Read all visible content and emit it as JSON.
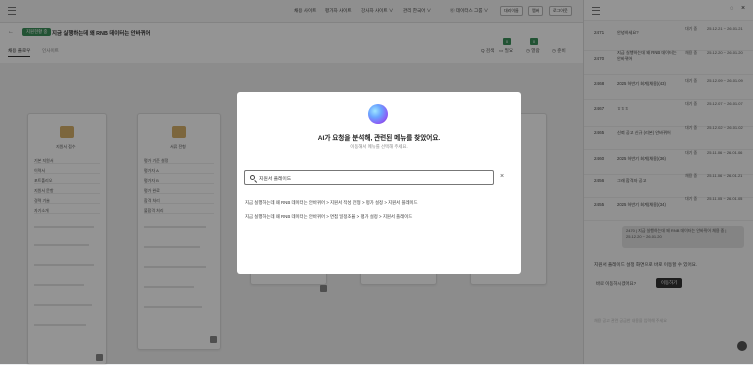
{
  "topbar": {
    "menu": [
      "채용 사이트",
      "평가자 사이트",
      "강사자 사이트 ∨",
      "관리 한국어 ∨",
      "⓪ 데이터스 그룹 ∨"
    ],
    "tags": [
      "대리이름",
      "멤버",
      "로그아웃"
    ]
  },
  "header": {
    "status": "지원현황 중",
    "title": "지금 실행하는데 왜 RNB 데이터는 안바뀌어",
    "tabs": [
      "채용 플로우",
      "인사이트"
    ],
    "tools": [
      "Q 검색",
      "▭ 필요",
      "◷ 열람",
      "◷ 준비"
    ],
    "badges": [
      "0",
      "0"
    ]
  },
  "cards": [
    {
      "title": "지원서 접수",
      "rows": [
        "기본 지원서",
        "이력서",
        "포트폴리오",
        "지원서 문항",
        "경력 기술",
        "자기소개"
      ]
    },
    {
      "title": "서류 전형",
      "rows": [
        "평가 기준 설정",
        "평가자 A",
        "평가자 B",
        "평가 완료",
        "합격 처리",
        "불합격 처리"
      ]
    }
  ],
  "history": [
    {
      "id": "2471",
      "title": "안녕하세요?",
      "status": "대기 중",
      "date": "25.12.21 ~ 26.01.21"
    },
    {
      "id": "2470",
      "title": "지금 실행하는데 왜 RNB 데이터는 안바뀌어",
      "status": "채용 중",
      "date": "25.12.20 ~ 26.01.20"
    },
    {
      "id": "2468",
      "title": "2025 하반기 회계(채용)(43)",
      "status": "대기 중",
      "date": "25.12.09 ~ 26.01.09"
    },
    {
      "id": "2467",
      "title": "ㅎㅎㅎ",
      "status": "대기 중",
      "date": "25.12.07 ~ 26.01.07"
    },
    {
      "id": "2465",
      "title": "신뢰 공고 신규 (리본) 안바뀌어",
      "status": "대기 중",
      "date": "25.12.02 ~ 26.01.02"
    },
    {
      "id": "2460",
      "title": "2025 하반기 회계(채용)(36)",
      "status": "대기 중",
      "date": "25.11.06 ~ 26.01.06"
    },
    {
      "id": "2456",
      "title": "그래 합격자 공고",
      "status": "채용 중",
      "date": "25.11.06 ~ 26.01.21"
    },
    {
      "id": "2455",
      "title": "2025 하반기 회계(채용)(34)",
      "status": "대기 중",
      "date": "25.11.05 ~ 26.01.05"
    }
  ],
  "chat": {
    "bubble": "2470 | 지금 실행하는데 왜 RNB 데이터는 안바뀌어 채용 중 | 25.12.20 ~ 26.01.20",
    "message": "지원서 플레이드 설정 화면으로 바로 이동할 수 있어요.",
    "question": "바로 이동하시겠어요?",
    "move_button": "이동하기",
    "input_placeholder": "채용 공고 관련 궁금한 내용을 입력해 주세요"
  },
  "modal": {
    "title": "AI가 요청을 분석해, 관련된 메뉴를 찾았어요.",
    "subtitle": "이동해서 메뉴를 선택해 주세요.",
    "search_value": "지원서 플레이드",
    "results": [
      "지금 실행하는데 왜 RNB 데이터는 안바뀌어 > 지원서 작성 전형 > 평가 설정 > 지원서 플레이드",
      "지금 실행하는데 왜 RNB 데이터는 안바뀌어 > 면접 일정조율 > 평가 설정 > 지원서 플레이드"
    ]
  }
}
